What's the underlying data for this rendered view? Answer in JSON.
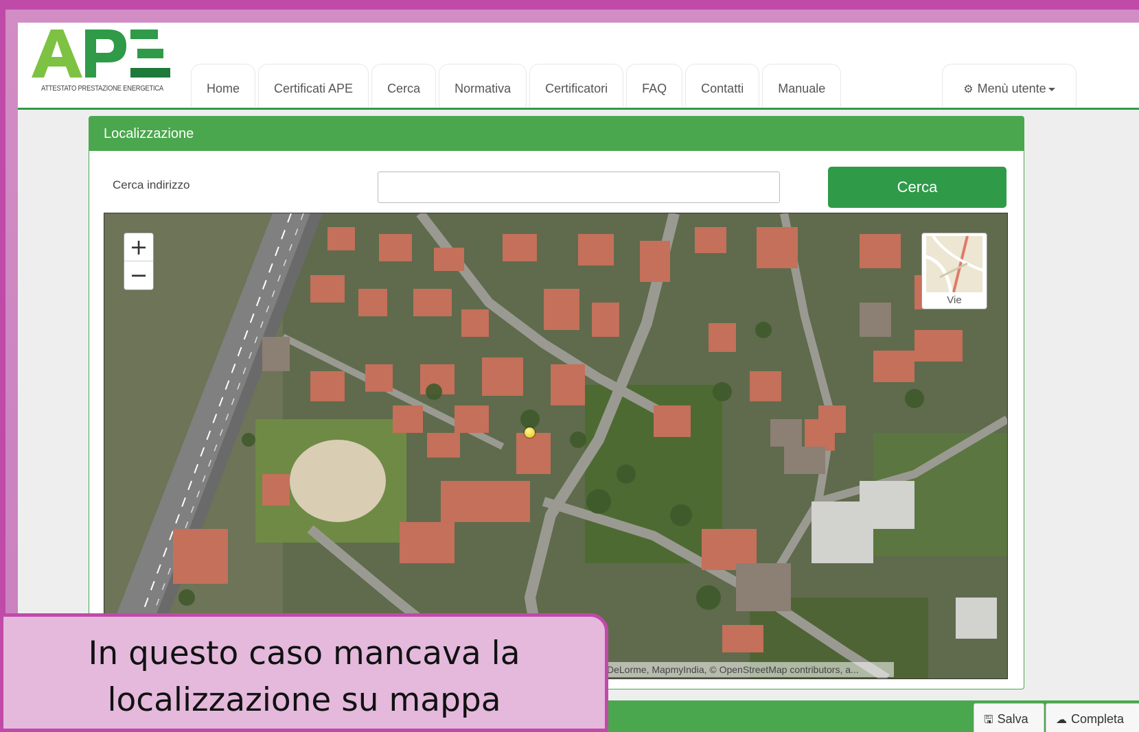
{
  "logo": {
    "letters": "APE",
    "subtitle": "ATTESTATO PRESTAZIONE ENERGETICA"
  },
  "nav": {
    "tabs": [
      "Home",
      "Certificati APE",
      "Cerca",
      "Normativa",
      "Certificatori",
      "FAQ",
      "Contatti",
      "Manuale"
    ],
    "user_menu": "Menù utente"
  },
  "panel": {
    "title": "Localizzazione",
    "address_label": "Cerca indirizzo",
    "address_value": "",
    "search_button": "Cerca"
  },
  "map": {
    "zoom_in": "+",
    "zoom_out": "−",
    "layer_label": "Vie",
    "attribution": "DeLorme, MapmyIndia, © OpenStreetMap contributors, a..."
  },
  "actions": {
    "save": "Salva",
    "complete": "Completa"
  },
  "caption": {
    "line1": "In questo caso mancava la",
    "line2": "localizzazione su mappa"
  },
  "colors": {
    "brand_green": "#2f9a48",
    "panel_green": "#4aa74d",
    "frame_pink": "#c04aa8",
    "caption_bg": "#e4b9dc"
  }
}
